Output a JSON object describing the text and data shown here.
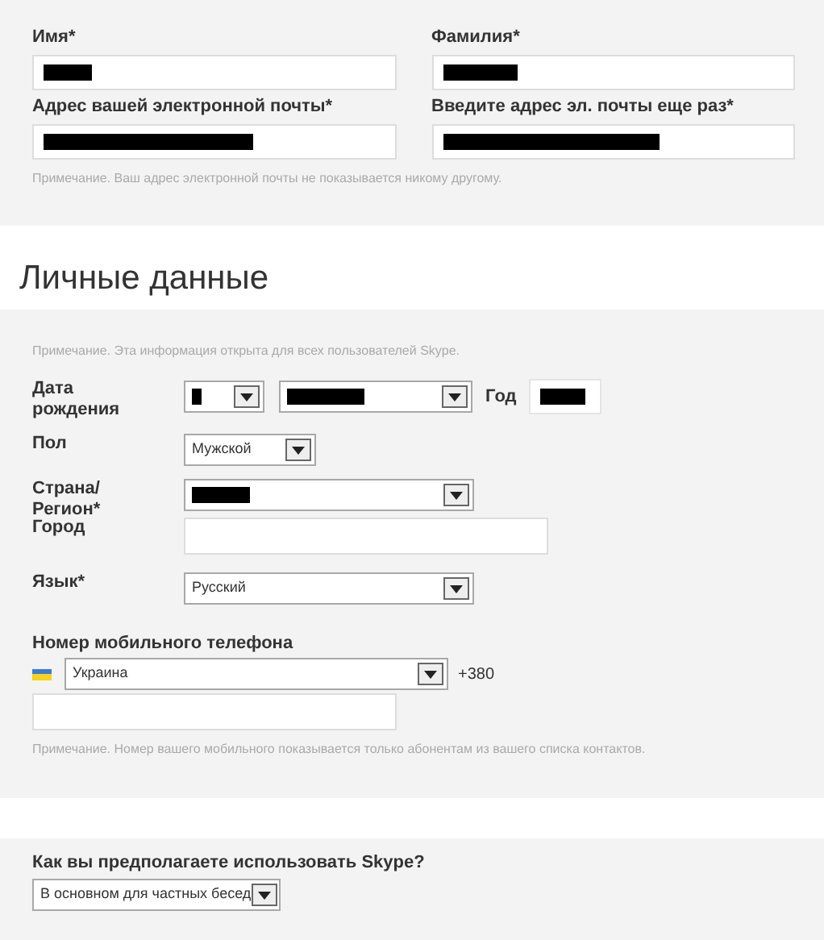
{
  "account": {
    "fields": [
      {
        "label": "Имя*",
        "redacted": true
      },
      {
        "label": "Фамилия*",
        "redacted": true
      },
      {
        "label": "Адрес вашей электронной почты*",
        "redacted": true
      },
      {
        "label": "Введите адрес эл. почты еще раз*",
        "redacted": true
      }
    ],
    "note": "Примечание. Ваш адрес электронной почты не показывается никому другому."
  },
  "personal": {
    "title": "Личные данные",
    "note": "Примечание. Эта информация открыта для всех пользователей Skype.",
    "birth_date": {
      "label": "Дата рождения",
      "day": {
        "redacted": true
      },
      "month": {
        "redacted": true
      },
      "year_label": "Год",
      "year": {
        "redacted": true
      }
    },
    "gender": {
      "label": "Пол",
      "value": "Мужской"
    },
    "country": {
      "label": "Страна/ Регион*",
      "redacted": true
    },
    "city": {
      "label": "Город"
    },
    "language": {
      "label": "Язык*",
      "value": "Русский"
    },
    "phone": {
      "label": "Номер мобильного телефона",
      "country": "Украина",
      "code": "+380",
      "note": "Примечание. Номер вашего мобильного показывается только абонентам из вашего списка контактов."
    }
  },
  "usage": {
    "question": "Как вы предполагаете использовать Skype?",
    "value": "В основном для частных бесед"
  }
}
